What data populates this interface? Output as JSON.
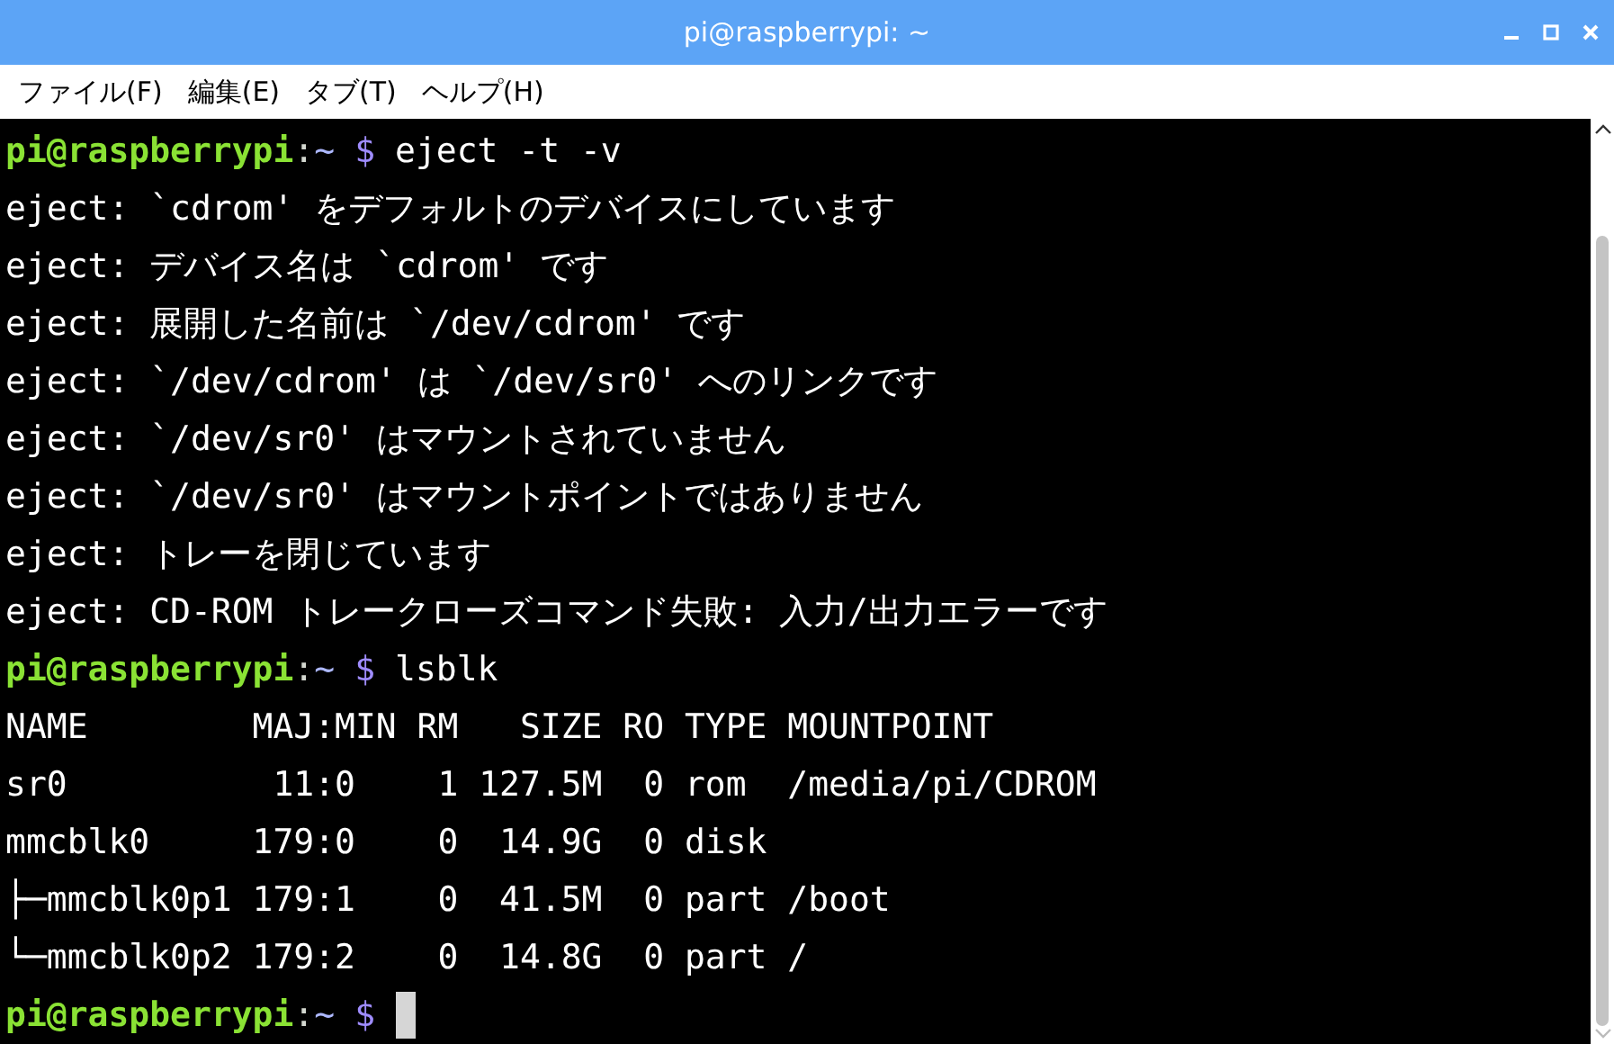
{
  "window": {
    "title": "pi@raspberrypi: ~"
  },
  "menu": [
    "ファイル(F)",
    "編集(E)",
    "タブ(T)",
    "ヘルプ(H)"
  ],
  "terminal": {
    "lines": [
      {
        "kind": "prompt",
        "user": "pi@raspberrypi",
        "sep": ":",
        "path": "~",
        "symbol": "$",
        "command": "eject -t -v"
      },
      {
        "kind": "output",
        "text": "eject: `cdrom' をデフォルトのデバイスにしています"
      },
      {
        "kind": "output",
        "text": "eject: デバイス名は `cdrom' です"
      },
      {
        "kind": "output",
        "text": "eject: 展開した名前は `/dev/cdrom' です"
      },
      {
        "kind": "output",
        "text": "eject: `/dev/cdrom' は `/dev/sr0' へのリンクです"
      },
      {
        "kind": "output",
        "text": "eject: `/dev/sr0' はマウントされていません"
      },
      {
        "kind": "output",
        "text": "eject: `/dev/sr0' はマウントポイントではありません"
      },
      {
        "kind": "output",
        "text": "eject: トレーを閉じています"
      },
      {
        "kind": "output",
        "text": "eject: CD-ROM トレークローズコマンド失敗: 入力/出力エラーです"
      },
      {
        "kind": "prompt",
        "user": "pi@raspberrypi",
        "sep": ":",
        "path": "~",
        "symbol": "$",
        "command": "lsblk"
      },
      {
        "kind": "output",
        "text": "NAME        MAJ:MIN RM   SIZE RO TYPE MOUNTPOINT"
      },
      {
        "kind": "output",
        "text": "sr0          11:0    1 127.5M  0 rom  /media/pi/CDROM"
      },
      {
        "kind": "output",
        "text": "mmcblk0     179:0    0  14.9G  0 disk"
      },
      {
        "kind": "output",
        "text": "├─mmcblk0p1 179:1    0  41.5M  0 part /boot"
      },
      {
        "kind": "output",
        "text": "└─mmcblk0p2 179:2    0  14.8G  0 part /"
      },
      {
        "kind": "prompt",
        "user": "pi@raspberrypi",
        "sep": ":",
        "path": "~",
        "symbol": "$",
        "cursor": true
      }
    ]
  }
}
